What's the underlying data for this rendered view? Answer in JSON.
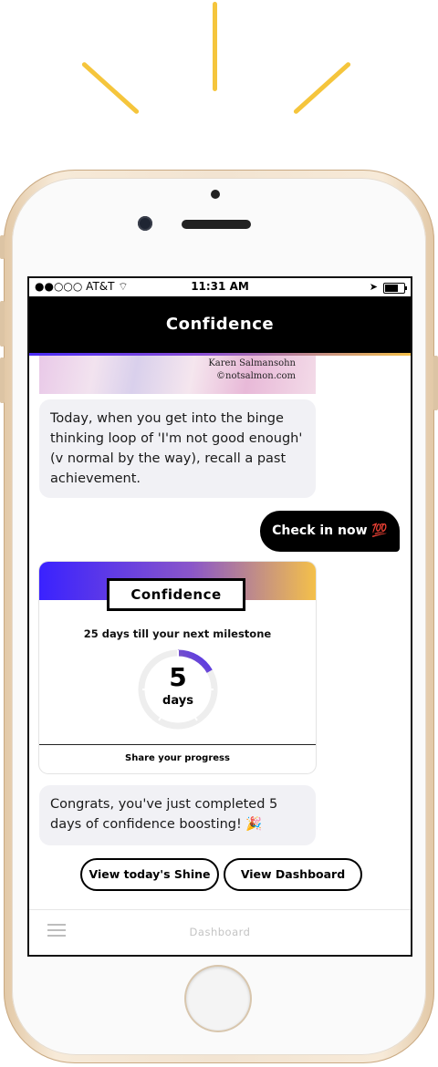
{
  "status_bar": {
    "carrier": "●●○○○ AT&T ⌔",
    "time": "11:31 AM",
    "location_icon": "location-arrow-icon",
    "battery_icon": "battery-icon"
  },
  "header": {
    "title": "Confidence"
  },
  "image": {
    "credit_line1": "Karen Salmansohn",
    "credit_line2": "©notsalmon.com"
  },
  "messages": {
    "tip": "Today, when you get into the binge thinking loop of 'I'm not good enough' (v normal by the way), recall a past achievement.",
    "check_in": "Check in now 💯",
    "congrats": "Congrats, you've just completed 5 days of confidence boosting! 🎉"
  },
  "progress_card": {
    "title": "Confidence",
    "milestone_text": "25 days till your next milestone",
    "days_value": "5",
    "days_label": "days",
    "progress_fraction": 0.167,
    "share_label": "Share your progress",
    "colors": {
      "gradient_start": "#3a22ff",
      "gradient_end": "#f4c04a"
    }
  },
  "actions": {
    "shine_label": "View today's Shine",
    "dashboard_label": "View Dashboard"
  },
  "tab_bar": {
    "menu_icon": "hamburger-menu-icon",
    "label": "Dashboard"
  }
}
